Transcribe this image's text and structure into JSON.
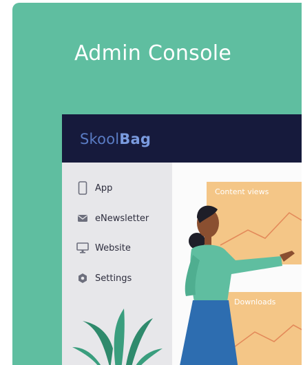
{
  "card": {
    "title": "Admin Console",
    "background": "#5fbea0"
  },
  "app": {
    "brand_prefix": "Skool",
    "brand_suffix": "Bag",
    "topbar_color": "#161a3c"
  },
  "sidebar": {
    "items": [
      {
        "label": "App",
        "icon": "phone-icon"
      },
      {
        "label": "eNewsletter",
        "icon": "mail-icon"
      },
      {
        "label": "Website",
        "icon": "monitor-icon"
      },
      {
        "label": "Settings",
        "icon": "gear-icon"
      }
    ]
  },
  "panels": {
    "content_views": "Content views",
    "downloads": "Downloads",
    "color": "#f4c687"
  }
}
